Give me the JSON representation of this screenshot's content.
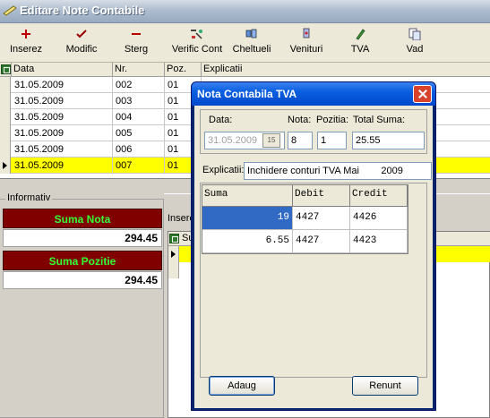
{
  "window": {
    "title": "Editare Note Contabile"
  },
  "toolbar": {
    "buttons": [
      {
        "label": "Inserez",
        "icon": "plus-icon"
      },
      {
        "label": "Modific",
        "icon": "checkmark-icon"
      },
      {
        "label": "Sterg",
        "icon": "minus-icon"
      },
      {
        "label": "Verific Cont",
        "icon": "verify-account-icon"
      },
      {
        "label": "Cheltueli",
        "icon": "expenses-icon"
      },
      {
        "label": "Venituri",
        "icon": "income-icon"
      },
      {
        "label": "TVA",
        "icon": "pen-icon"
      },
      {
        "label": "Vad",
        "icon": "view-document-icon"
      }
    ]
  },
  "grid": {
    "headers": [
      "Data",
      "Nr.",
      "Poz.",
      "Explicatii"
    ],
    "rows": [
      {
        "data": "31.05.2009",
        "nr": "002",
        "poz": "01"
      },
      {
        "data": "31.05.2009",
        "nr": "003",
        "poz": "01"
      },
      {
        "data": "31.05.2009",
        "nr": "004",
        "poz": "01"
      },
      {
        "data": "31.05.2009",
        "nr": "005",
        "poz": "01"
      },
      {
        "data": "31.05.2009",
        "nr": "006",
        "poz": "01"
      },
      {
        "data": "31.05.2009",
        "nr": "007",
        "poz": "01"
      }
    ],
    "selected_row": 5
  },
  "info": {
    "legend": "Informativ",
    "suma_nota_label": "Suma Nota",
    "suma_nota_value": "294.45",
    "suma_pozitie_label": "Suma Pozitie",
    "suma_pozitie_value": "294.45"
  },
  "lower": {
    "insere_label": "Insere",
    "col_label": "Su"
  },
  "dialog": {
    "title": "Nota Contabila TVA",
    "data_label": "Data:",
    "data_value": "31.05.2009",
    "calendar_label": "15",
    "nota_label": "Nota:",
    "nota_value": "8",
    "pozitia_label": "Pozitia:",
    "pozitia_value": "1",
    "total_label": "Total Suma:",
    "total_value": "25.55",
    "explicatii_label": "Explicatii:",
    "explicatii_value": "Inchidere conturi TVA Mai        2009",
    "table": {
      "headers": [
        "Suma",
        "Debit",
        "Credit"
      ],
      "rows": [
        {
          "suma": "19",
          "debit": "4427",
          "credit": "4426"
        },
        {
          "suma": "6.55",
          "debit": "4427",
          "credit": "4423"
        }
      ]
    },
    "adaug_label": "Adaug",
    "renunt_label": "Renunt"
  },
  "colors": {
    "selected_row": "#ffff00",
    "info_bar": "#800000",
    "info_text": "#33ff33",
    "dialog_title": "#0a5fe0"
  }
}
